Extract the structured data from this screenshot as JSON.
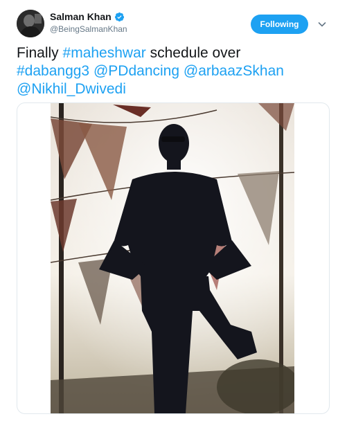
{
  "user": {
    "display_name": "Salman Khan",
    "handle": "@BeingSalmanKhan",
    "verified": true
  },
  "actions": {
    "follow_label": "Following",
    "menu_icon": "chevron-down-icon"
  },
  "tweet": {
    "text_plain_1": "Finally ",
    "hashtag_1": "#maheshwar",
    "text_plain_2": " schedule over",
    "hashtag_2": "#dabangg3",
    "mention_1": "@PDdancing",
    "mention_2": "@arbaazSkhan",
    "mention_3": "@Nikhil_Dwivedi"
  },
  "colors": {
    "link": "#1da1f2",
    "button": "#1da1f2",
    "secondary_text": "#657786"
  }
}
